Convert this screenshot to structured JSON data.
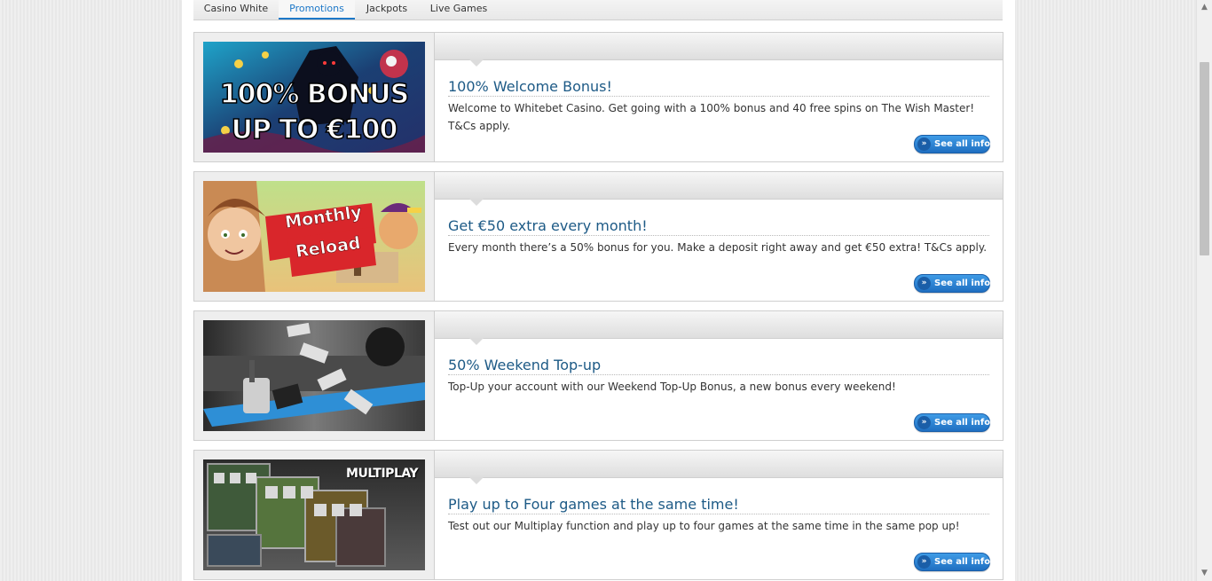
{
  "tabs": [
    {
      "label": "Casino White",
      "active": false
    },
    {
      "label": "Promotions",
      "active": true
    },
    {
      "label": "Jackpots",
      "active": false
    },
    {
      "label": "Live Games",
      "active": false
    }
  ],
  "promotions": [
    {
      "title": "100% Welcome Bonus!",
      "description": "Welcome to Whitebet Casino. Get going with a 100% bonus and 40 free spins on The Wish Master! T&Cs apply.",
      "image_text": [
        "100% BONUS",
        "UP TO €100"
      ],
      "button_label": "See all info"
    },
    {
      "title": "Get €50 extra every month!",
      "description": "Every month there’s a 50% bonus for you. Make a deposit right away and get €50 extra! T&Cs apply.",
      "image_text": [
        "Monthly",
        "Reload"
      ],
      "button_label": "See all info"
    },
    {
      "title": "50% Weekend Top-up",
      "description": "Top-Up your account with our Weekend Top-Up Bonus, a new bonus every weekend!",
      "image_text": [],
      "button_label": "See all info"
    },
    {
      "title": "Play up to Four games at the same time!",
      "description": "Test out our Multiplay function and play up to four games at the same time in the same pop up!",
      "image_text": [
        "MULTIPLAY"
      ],
      "button_label": "See all info"
    }
  ],
  "colors": {
    "accent": "#1d78c8",
    "title": "#1d5a86",
    "button": "#2a80d0",
    "background": "#ececec"
  },
  "icons": {
    "button_chevron": "double-chevron-right-icon",
    "scroll_up": "triangle-up-icon",
    "scroll_down": "triangle-down-icon"
  }
}
